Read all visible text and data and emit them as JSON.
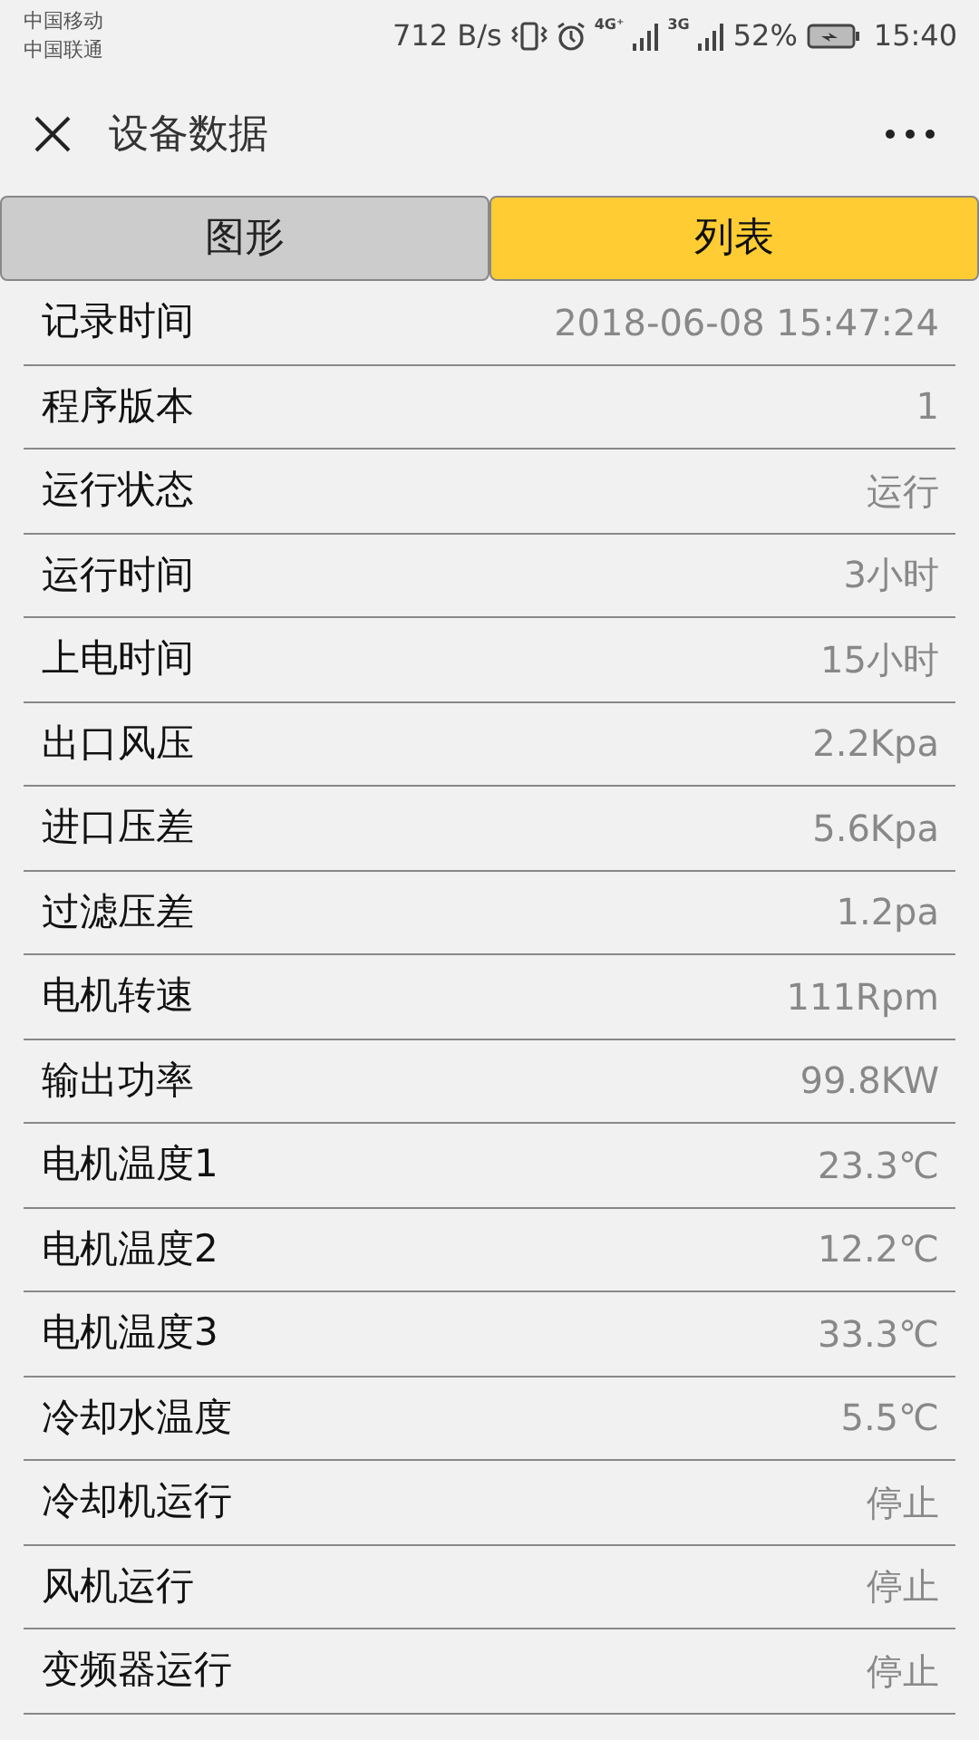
{
  "status_bar": {
    "carriers": [
      "中国移动",
      "中国联通"
    ],
    "speed": "712 B/s",
    "network_1": "4G⁺",
    "network_2": "3G",
    "battery": "52%",
    "time": "15:40"
  },
  "header": {
    "title": "设备数据"
  },
  "tabs": [
    {
      "label": "图形",
      "selected": false
    },
    {
      "label": "列表",
      "selected": true
    }
  ],
  "rows": [
    {
      "label": "记录时间",
      "value": "2018-06-08 15:47:24"
    },
    {
      "label": "程序版本",
      "value": "1"
    },
    {
      "label": "运行状态",
      "value": "运行"
    },
    {
      "label": "运行时间",
      "value": "3小时"
    },
    {
      "label": "上电时间",
      "value": "15小时"
    },
    {
      "label": "出口风压",
      "value": "2.2Kpa"
    },
    {
      "label": "进口压差",
      "value": "5.6Kpa"
    },
    {
      "label": "过滤压差",
      "value": "1.2pa"
    },
    {
      "label": "电机转速",
      "value": "111Rpm"
    },
    {
      "label": "输出功率",
      "value": "99.8KW"
    },
    {
      "label": "电机温度1",
      "value": "23.3℃"
    },
    {
      "label": "电机温度2",
      "value": "12.2℃"
    },
    {
      "label": "电机温度3",
      "value": "33.3℃"
    },
    {
      "label": "冷却水温度",
      "value": "5.5℃"
    },
    {
      "label": "冷却机运行",
      "value": "停止"
    },
    {
      "label": "风机运行",
      "value": "停止"
    },
    {
      "label": "变频器运行",
      "value": "停止"
    }
  ]
}
